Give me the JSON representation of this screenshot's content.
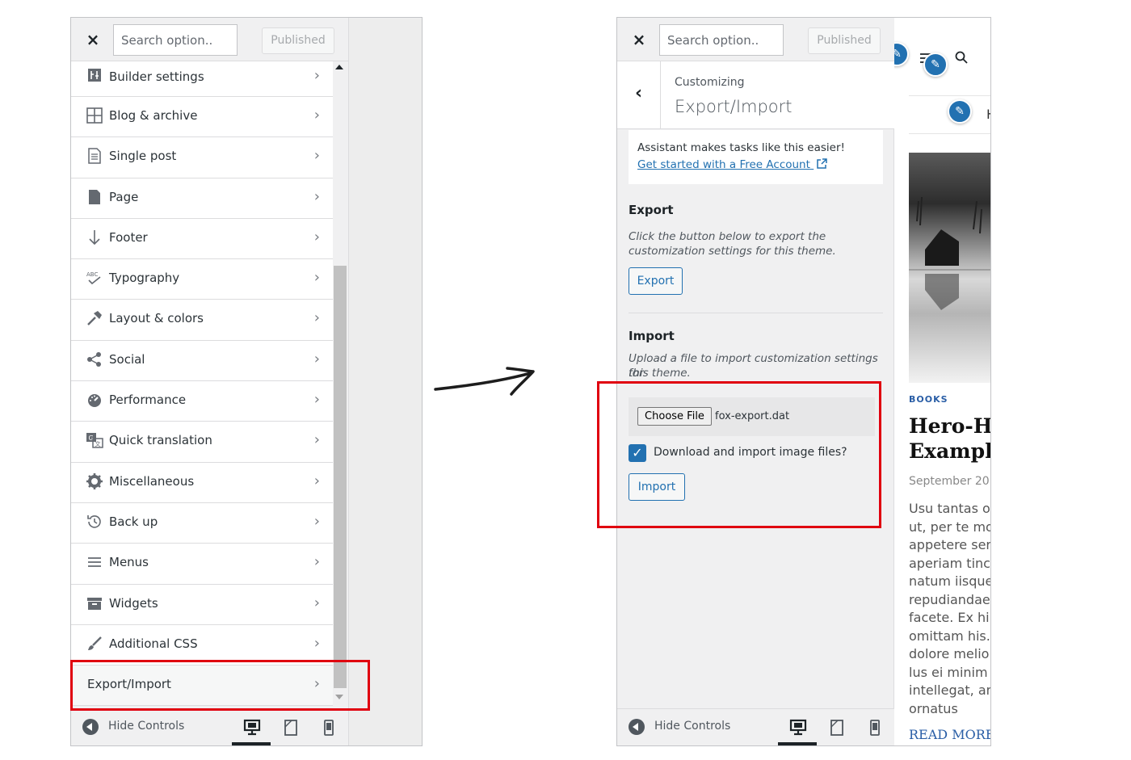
{
  "left": {
    "close_label": "×",
    "search_placeholder": "Search option..",
    "published_label": "Published",
    "menu_items": [
      {
        "label": "Builder settings"
      },
      {
        "label": "Blog & archive"
      },
      {
        "label": "Single post"
      },
      {
        "label": "Page"
      },
      {
        "label": "Footer"
      },
      {
        "label": "Typography"
      },
      {
        "label": "Layout & colors"
      },
      {
        "label": "Social"
      },
      {
        "label": "Performance"
      },
      {
        "label": "Quick translation"
      },
      {
        "label": "Miscellaneous"
      },
      {
        "label": "Back up"
      },
      {
        "label": "Menus"
      },
      {
        "label": "Widgets"
      },
      {
        "label": "Additional CSS"
      },
      {
        "label": "Export/Import"
      }
    ],
    "hide_controls_label": "Hide Controls"
  },
  "right": {
    "close_label": "×",
    "search_placeholder": "Search option..",
    "published_label": "Published",
    "breadcrumb": "Customizing",
    "section_title": "Export/Import",
    "assistant_text": "Assistant makes tasks like this easier!",
    "assistant_link": "Get started with a Free Account",
    "export_heading": "Export",
    "export_desc_1": "Click the button below to export the",
    "export_desc_2": "customization settings for this theme.",
    "export_button": "Export",
    "import_heading": "Import",
    "import_desc_1": "Upload a file to import customization settings for",
    "import_desc_2": "this theme.",
    "choose_file_label": "Choose File",
    "file_name": "fox-export.dat",
    "checkbox_checked": true,
    "checkbox_label": "Download and import image files?",
    "import_button": "Import",
    "hide_controls_label": "Hide Controls"
  },
  "preview": {
    "nav_letter": "H",
    "category": "BOOKS",
    "title_line_1": "Hero-Ha",
    "title_line_2": "Example",
    "date": "September 20",
    "body_lines": [
      "Usu tantas o",
      "ut, per te mo",
      "appetere ser",
      "aperiam tinci",
      "natum iisque",
      "repudiandae",
      "facete. Ex hi",
      "omittam his.",
      "dolore melio",
      "lus ei minim",
      "intellegat, an",
      "ornatus"
    ],
    "read_more": "READ MORE"
  },
  "icons": {
    "devices": [
      "desktop-icon",
      "tablet-icon",
      "mobile-icon"
    ]
  },
  "colors": {
    "accent": "#2271b1",
    "highlight": "#e0000f"
  }
}
